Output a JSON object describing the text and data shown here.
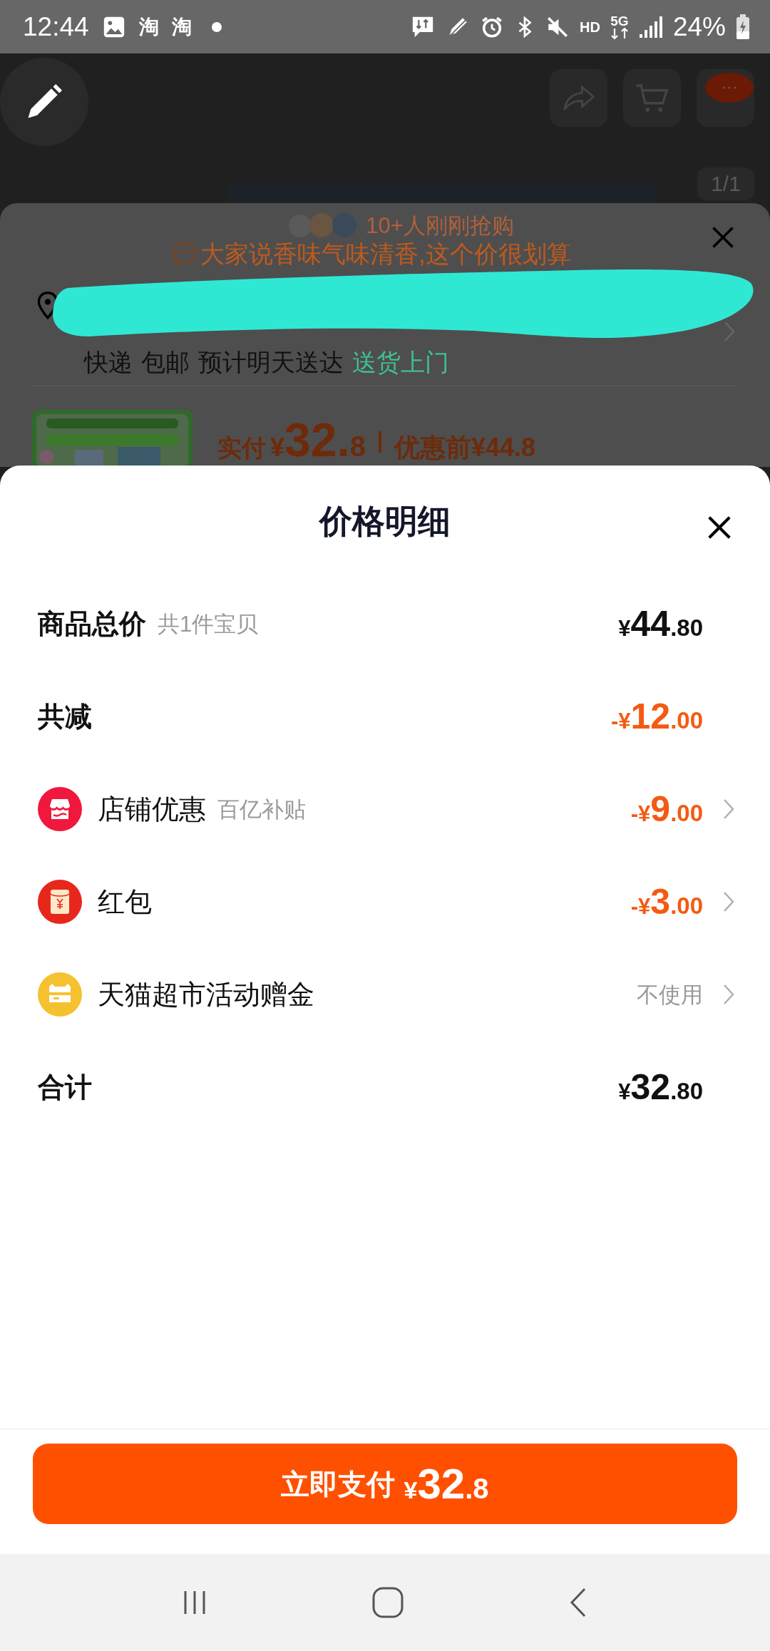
{
  "status_bar": {
    "time": "12:44",
    "notification_glyphs": [
      "淘",
      "淘"
    ],
    "hd_label": "HD",
    "network": "5G",
    "battery": "24%"
  },
  "header": {
    "image_counter": "1/1"
  },
  "product_sheet": {
    "buyers_note": "10+人刚刚抢购",
    "review": "大家说香味气味清香,这个价很划算",
    "delivery": [
      "快递",
      "包邮",
      "预计明天送达"
    ],
    "delivery_service": "送货上门",
    "paid_label": "实付",
    "paid_price": {
      "prefix": "¥",
      "integer": "32.",
      "decimal": "8"
    },
    "original_price": "优惠前¥44.8"
  },
  "price_detail": {
    "title": "价格明细",
    "rows": [
      {
        "kind": "total",
        "label": "商品总价",
        "note": "共1件宝贝",
        "price": {
          "prefix": "¥",
          "integer": "44",
          "decimal": ".80"
        }
      },
      {
        "kind": "reduction",
        "label": "共减",
        "price": {
          "prefix": "-¥",
          "integer": "12",
          "decimal": ".00"
        }
      },
      {
        "kind": "discount",
        "label": "店铺优惠",
        "note": "百亿补贴",
        "color": "#f0183c",
        "price": {
          "prefix": "-¥",
          "integer": "9",
          "decimal": ".00"
        }
      },
      {
        "kind": "discount",
        "label": "红包",
        "color": "#e8271c",
        "price": {
          "prefix": "-¥",
          "integer": "3",
          "decimal": ".00"
        }
      },
      {
        "kind": "option",
        "label": "天猫超市活动赠金",
        "color": "#f6c12f",
        "value": "不使用"
      },
      {
        "kind": "total",
        "label": "合计",
        "price": {
          "prefix": "¥",
          "integer": "32",
          "decimal": ".80"
        }
      }
    ]
  },
  "pay_button": {
    "label": "立即支付",
    "prefix": "¥",
    "integer": "32",
    "decimal": ".8"
  }
}
